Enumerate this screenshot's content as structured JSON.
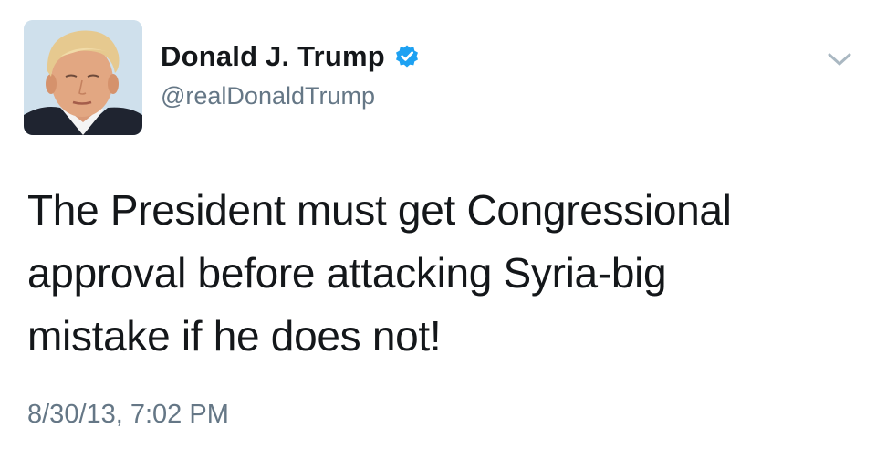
{
  "tweet": {
    "author": {
      "display_name": "Donald J. Trump",
      "handle": "@realDonaldTrump",
      "verified": true,
      "avatar_icon": "profile-photo"
    },
    "text_lines": [
      "The President must get Congressional",
      "approval before attacking Syria-big",
      "mistake if he does not!"
    ],
    "timestamp": "8/30/13, 7:02 PM",
    "menu_icon": "chevron-down-icon"
  },
  "colors": {
    "text": "#14171a",
    "secondary": "#657786",
    "verified_badge": "#1da1f2",
    "caret": "#aab8c2"
  }
}
